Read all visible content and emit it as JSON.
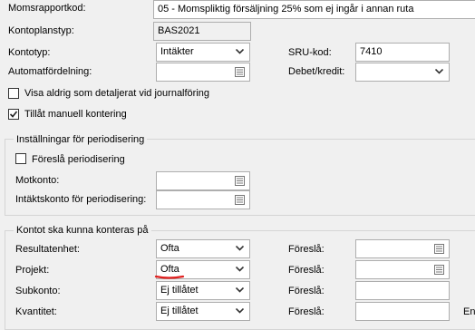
{
  "momsrapportkod": {
    "label": "Momsrapportkod:",
    "value": "05 - Momspliktig försäljning 25%  som ej ingår i annan ruta"
  },
  "kontoplanstyp": {
    "label": "Kontoplanstyp:",
    "value": "BAS2021"
  },
  "kontotyp": {
    "label": "Kontotyp:",
    "value": "Intäkter"
  },
  "sru_kod": {
    "label": "SRU-kod:",
    "value": "7410"
  },
  "automatfordelning": {
    "label": "Automatfördelning:",
    "value": ""
  },
  "debet_kredit": {
    "label": "Debet/kredit:",
    "value": ""
  },
  "visa_aldrig": {
    "label": "Visa aldrig som detaljerat vid journalföring",
    "checked": false
  },
  "tillat_manuell": {
    "label": "Tillåt manuell kontering",
    "checked": true
  },
  "periodisering": {
    "title": "Inställningar för periodisering",
    "foresla_label": "Föreslå periodisering",
    "foresla_checked": false,
    "motkonto_label": "Motkonto:",
    "motkonto_value": "",
    "intakt_label": "Intäktskonto för periodisering:",
    "intakt_value": ""
  },
  "kontering": {
    "title": "Kontot ska kunna konteras på",
    "rows": [
      {
        "label": "Resultatenhet:",
        "value": "Ofta",
        "foresla_label": "Föreslå:"
      },
      {
        "label": "Projekt:",
        "value": "Ofta",
        "foresla_label": "Föreslå:"
      },
      {
        "label": "Subkonto:",
        "value": "Ej tillåtet",
        "foresla_label": "Föreslå:"
      },
      {
        "label": "Kvantitet:",
        "value": "Ej tillåtet",
        "foresla_label": "Föreslå:"
      }
    ],
    "edge_text": "En"
  },
  "colors": {
    "annotation_underline": "#e0201f",
    "field_border": "#aeaeae",
    "background": "#f0f0f0"
  },
  "icons": [
    "chevron-down-icon",
    "list-picker-icon",
    "checkmark-icon"
  ]
}
